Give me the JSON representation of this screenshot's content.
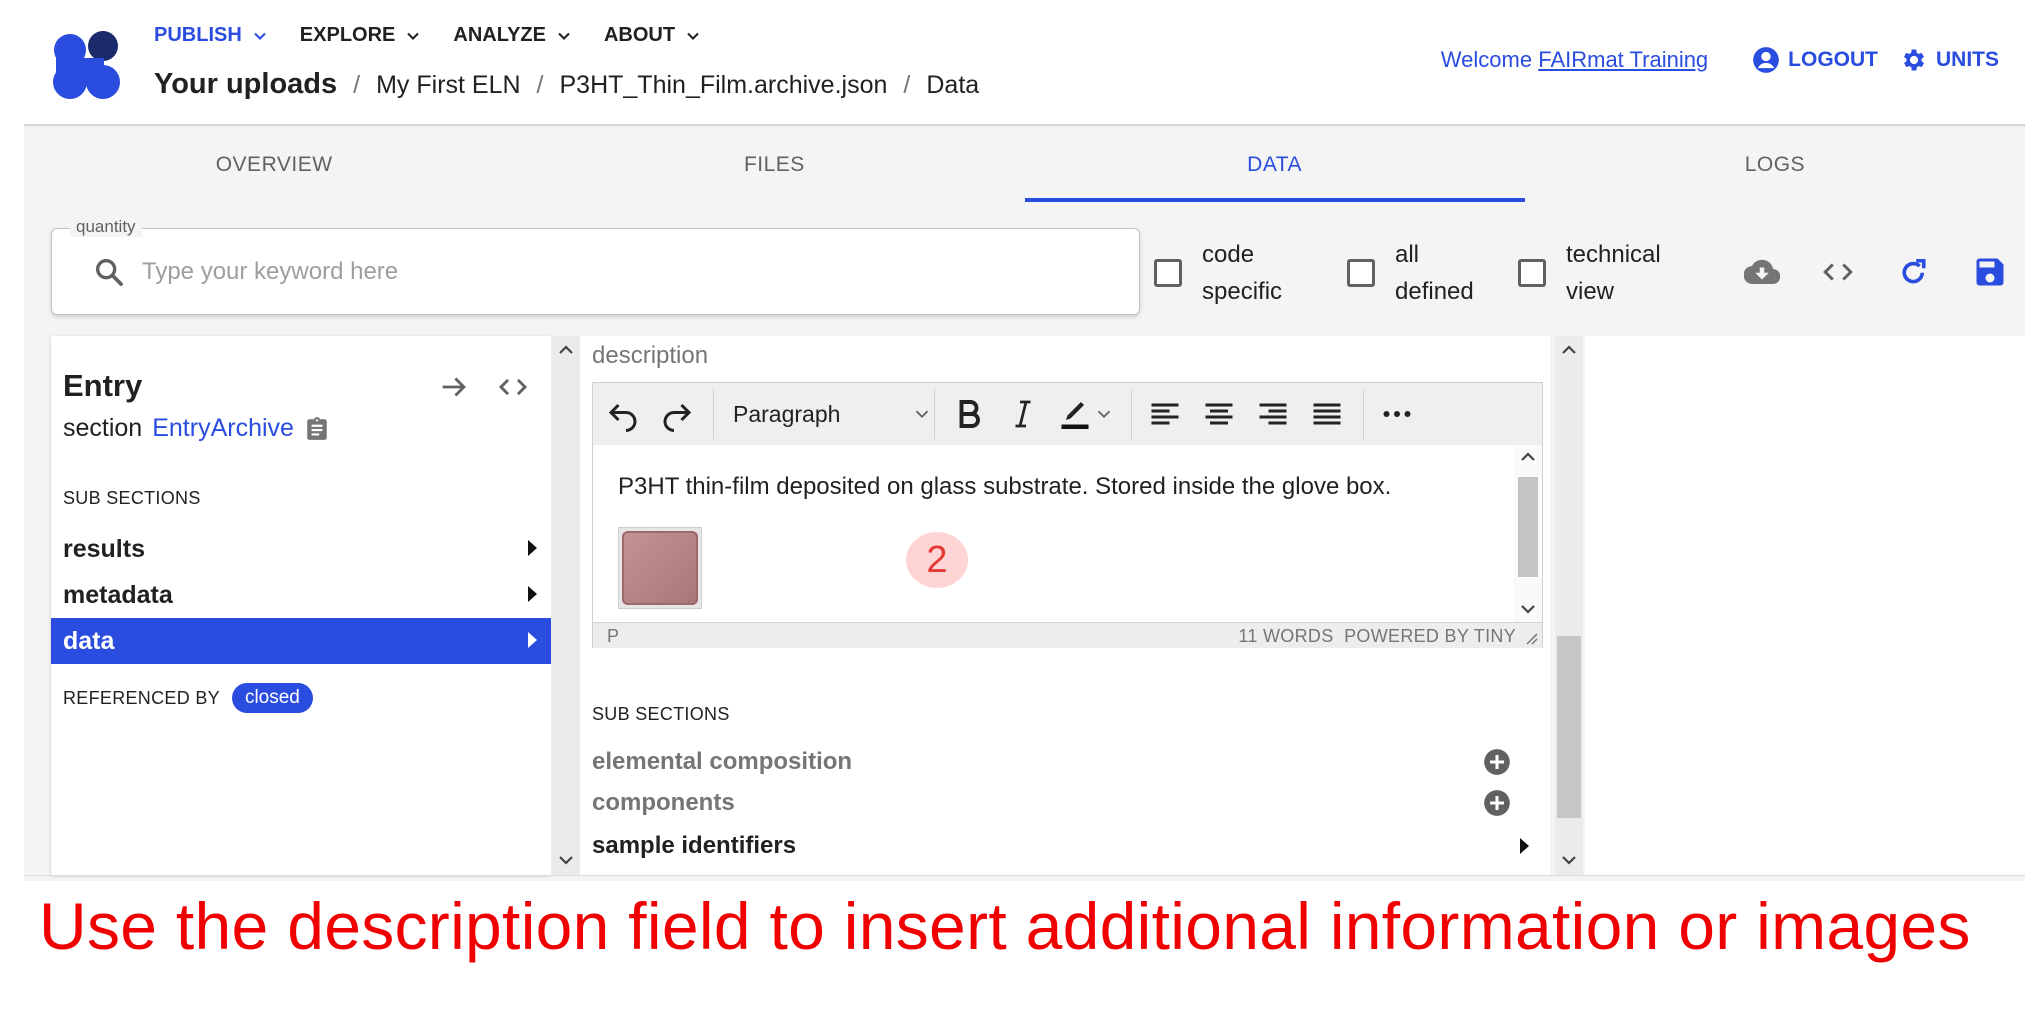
{
  "header": {
    "menu": [
      {
        "label": "PUBLISH",
        "active": true
      },
      {
        "label": "EXPLORE",
        "active": false
      },
      {
        "label": "ANALYZE",
        "active": false
      },
      {
        "label": "ABOUT",
        "active": false
      }
    ],
    "breadcrumb": {
      "root": "Your uploads",
      "items": [
        "My First ELN",
        "P3HT_Thin_Film.archive.json",
        "Data"
      ],
      "separator": "/"
    },
    "welcome_prefix": "Welcome",
    "user_name": "FAIRmat Training",
    "logout_label": "LOGOUT",
    "units_label": "UNITS"
  },
  "tabs": [
    {
      "label": "OVERVIEW",
      "active": false
    },
    {
      "label": "FILES",
      "active": false
    },
    {
      "label": "DATA",
      "active": true
    },
    {
      "label": "LOGS",
      "active": false
    }
  ],
  "filter": {
    "search_legend": "quantity",
    "search_placeholder": "Type your keyword here",
    "search_value": "",
    "checkboxes": [
      {
        "line1": "code",
        "line2": "specific",
        "checked": false
      },
      {
        "line1": "all",
        "line2": "defined",
        "checked": false
      },
      {
        "line1": "technical",
        "line2": "view",
        "checked": false
      }
    ],
    "actions": [
      "cloud-download-icon",
      "code-icon",
      "reload-icon",
      "save-icon"
    ]
  },
  "entry_lane": {
    "title": "Entry",
    "section_prefix": "section",
    "section_link": "EntryArchive",
    "sub_sections_heading": "SUB SECTIONS",
    "items": [
      {
        "label": "results",
        "selected": false
      },
      {
        "label": "metadata",
        "selected": false
      },
      {
        "label": "data",
        "selected": true
      }
    ],
    "referenced_by_label": "REFERENCED BY",
    "referenced_by_chip": "closed"
  },
  "data_lane": {
    "description_label": "description",
    "editor": {
      "block_format": "Paragraph",
      "content": "P3HT thin-film deposited on glass substrate. Stored inside the glove box.",
      "status_path": "P",
      "word_count": "11 WORDS",
      "powered_by": "POWERED BY TINY"
    },
    "step_badge": "2",
    "sub_sections_heading": "SUB SECTIONS",
    "sub_sections": [
      {
        "label": "elemental composition",
        "muted": true,
        "addable": true
      },
      {
        "label": "components",
        "muted": true,
        "addable": true
      },
      {
        "label": "sample identifiers",
        "muted": false,
        "addable": false
      }
    ]
  },
  "caption": "Use the description field to insert additional information or images",
  "colors": {
    "accent": "#2a4cdf",
    "caption": "#f00000",
    "badge_bg": "#ffd2d2",
    "badge_text": "#e53935"
  }
}
